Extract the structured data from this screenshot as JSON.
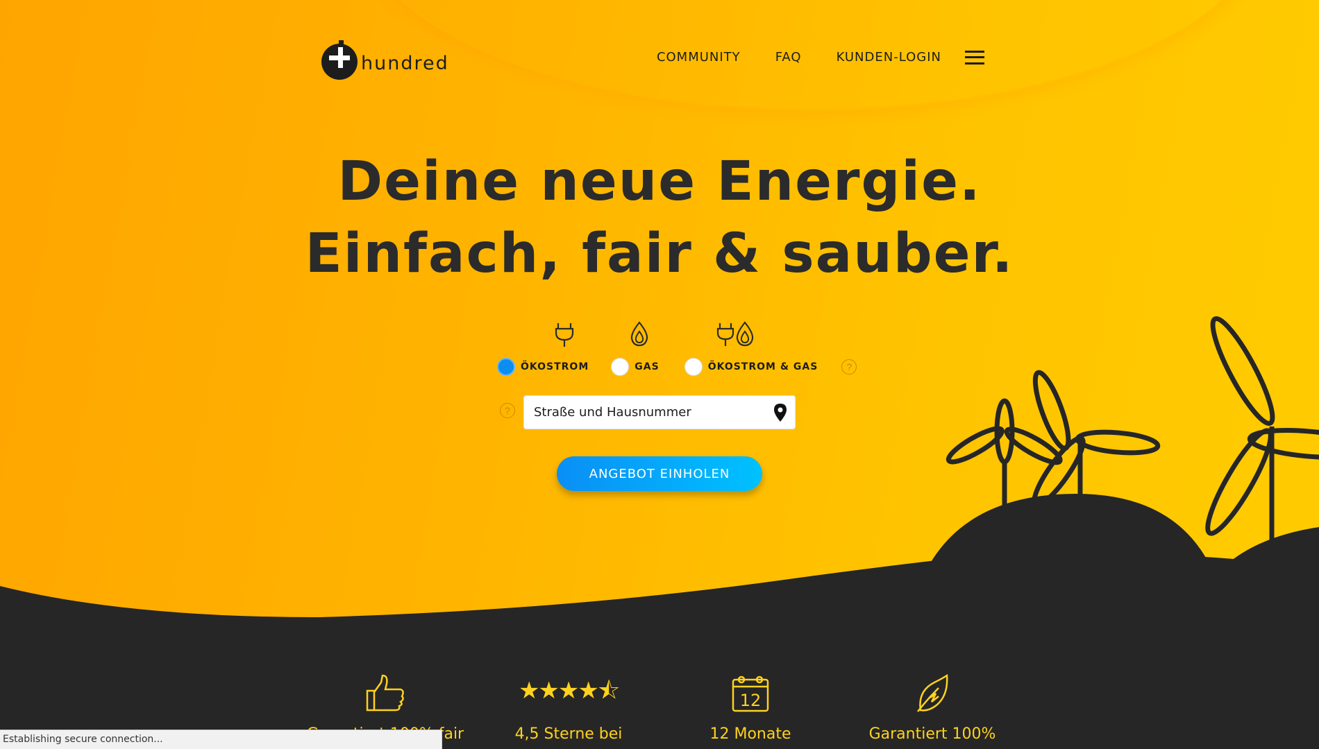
{
  "brand": {
    "name": "hundred"
  },
  "nav": {
    "items": [
      "COMMUNITY",
      "FAQ",
      "KUNDEN-LOGIN"
    ]
  },
  "hero": {
    "line1": "Deine neue Energie.",
    "line2": "Einfach, fair & sauber."
  },
  "form": {
    "options": [
      {
        "label": "ÖKOSTROM",
        "icon": "plug-icon",
        "selected": true
      },
      {
        "label": "GAS",
        "icon": "flame-icon",
        "selected": false
      },
      {
        "label": "ÖKOSTROM & GAS",
        "icon": "plug-flame-icon",
        "selected": false
      }
    ],
    "help_glyph": "?",
    "address_placeholder": "Straße und Hausnummer",
    "submit_label": "ANGEBOT EINHOLEN"
  },
  "features": [
    {
      "icon": "thumbs-up-icon",
      "text": "Garantiert 100% fair"
    },
    {
      "icon": "stars-icon",
      "text": "4,5 Sterne bei",
      "rating": 4.5,
      "stars_glyph": "★★★★⯪"
    },
    {
      "icon": "calendar-icon",
      "text": "12 Monate",
      "calendar_number": "12"
    },
    {
      "icon": "leaf-icon",
      "text": "Garantiert 100%"
    }
  ],
  "status": {
    "text": "Establishing secure connection..."
  },
  "colors": {
    "accent_blue": "#0b8ef0",
    "dark": "#262626",
    "yellow": "#ffcc00",
    "feature_yellow": "#ffd21f"
  }
}
